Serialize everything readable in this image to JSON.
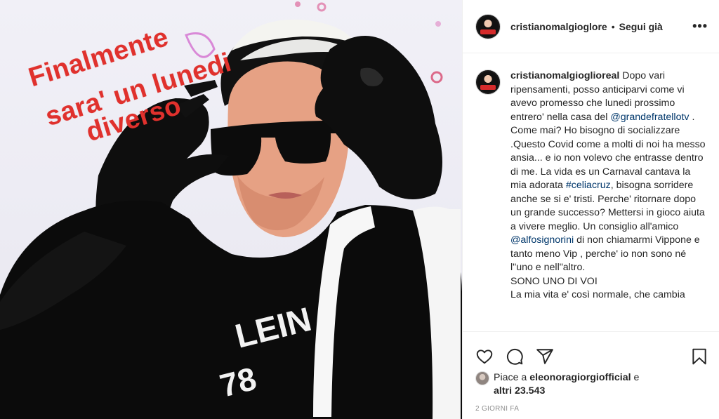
{
  "image": {
    "overlay_text": [
      "Finalmente",
      "sara' un lunedi",
      "diverso"
    ],
    "overlay_color": "#e0312d",
    "shirt_text": [
      "LEIN",
      "78"
    ]
  },
  "header": {
    "username": "cristianomalgioglore",
    "separator": "•",
    "follow_label": "Segui già",
    "more_icon": "more-horizontal-icon"
  },
  "caption": {
    "username": "cristianomalgioglioreal",
    "segments": [
      {
        "t": "Dopo vari ripensamenti, posso anticiparvi come vi avevo promesso che lunedi prossimo entrero' nella casa del "
      },
      {
        "tag": "@grandefratellotv"
      },
      {
        "t": " . Come mai? Ho bisogno di socializzare .Questo Covid come a molti di noi ha messo ansia... e io non volevo che entrasse dentro di me. La vida es un Carnaval cantava la mia adorata "
      },
      {
        "tag": "#celiacruz"
      },
      {
        "t": ", bisogna sorridere anche se si e' tristi. Perche' ritornare dopo un grande successo? Mettersi in gioco aiuta a vivere meglio. Un consiglio all'amico "
      },
      {
        "tag": "@alfosignorini"
      },
      {
        "t": " di non chiamarmi Vippone e tanto meno Vip , perche' io non sono né l\"uno e nell\"altro."
      }
    ],
    "line_after": "SONO UNO DI VOI",
    "line_cut": "La mia vita e' così normale, che cambia"
  },
  "actions": {
    "like_icon": "heart-icon",
    "comment_icon": "comment-icon",
    "share_icon": "share-icon",
    "save_icon": "bookmark-icon"
  },
  "likes": {
    "prefix": "Piace a",
    "user": "eleonoragiorgiofficial",
    "connector": "e",
    "others": "altri 23.543"
  },
  "timestamp": "2 GIORNI FA",
  "colors": {
    "link": "#00376b",
    "text": "#262626",
    "muted": "#8e8e8e",
    "border": "#efefef"
  }
}
